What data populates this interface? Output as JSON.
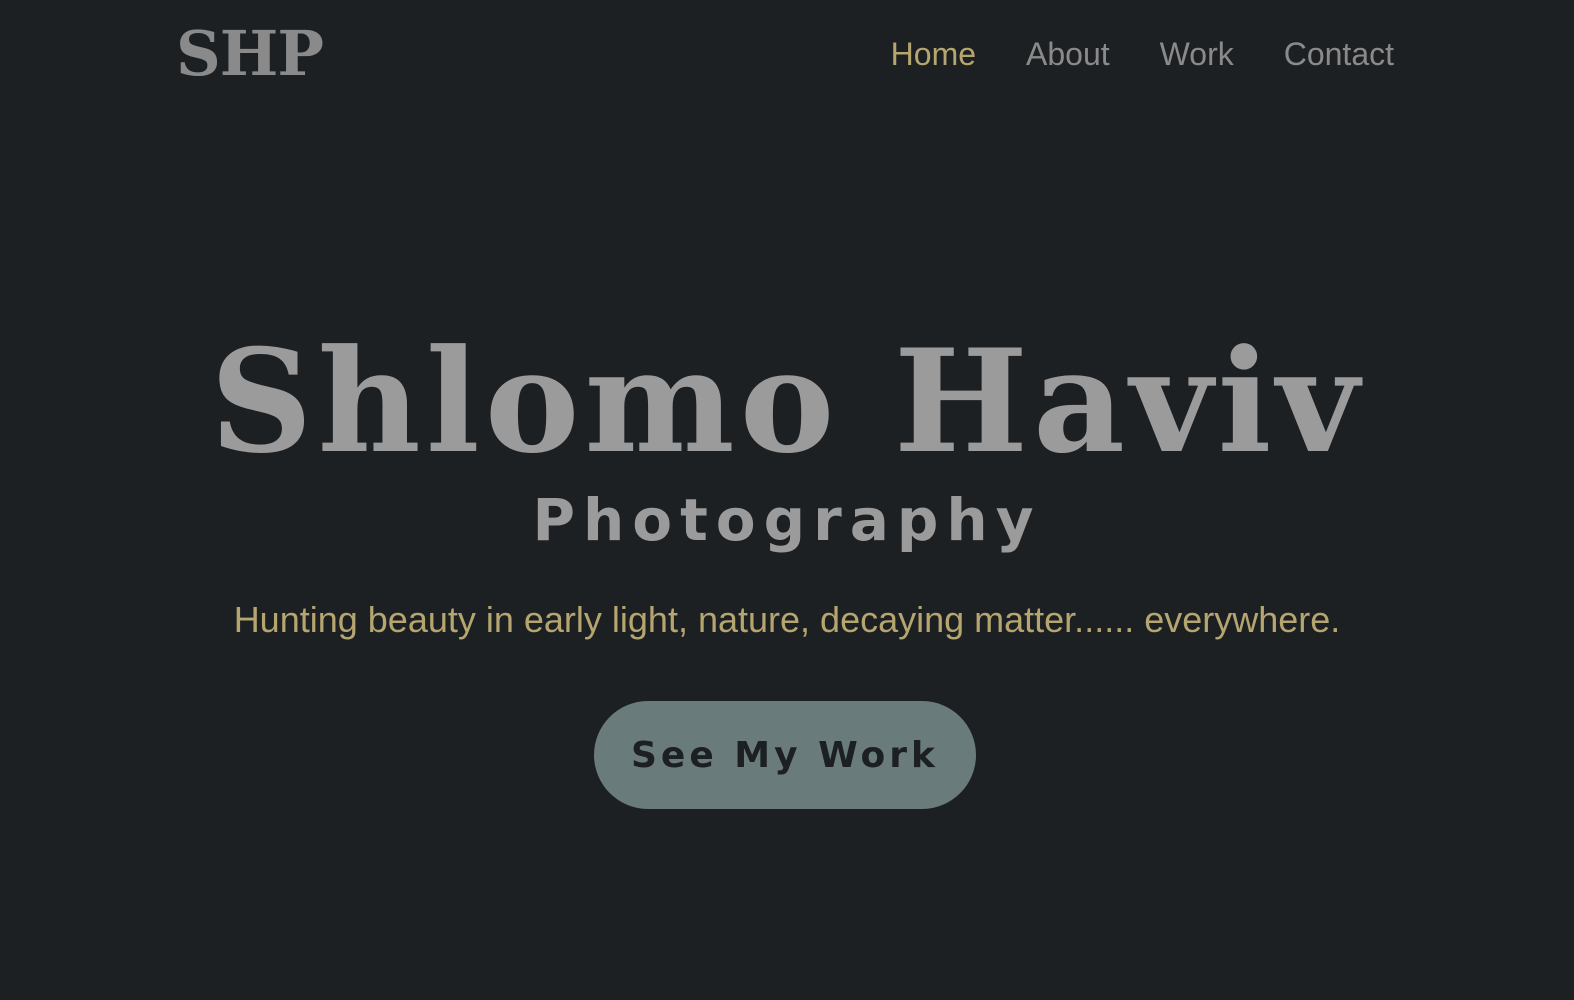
{
  "header": {
    "logo_text": "SHP",
    "nav": [
      {
        "label": "Home",
        "active": true
      },
      {
        "label": "About",
        "active": false
      },
      {
        "label": "Work",
        "active": false
      },
      {
        "label": "Contact",
        "active": false
      }
    ]
  },
  "hero": {
    "name": "Shlomo Haviv",
    "subtitle": "Photography",
    "tagline": "Hunting beauty in early light, nature, decaying matter...... everywhere.",
    "cta_label": "See My Work"
  },
  "colors": {
    "background": "#1d2023",
    "accent": "#b5a56f",
    "muted_text": "#8a8a8a",
    "button_bg": "#6a7b7c"
  }
}
